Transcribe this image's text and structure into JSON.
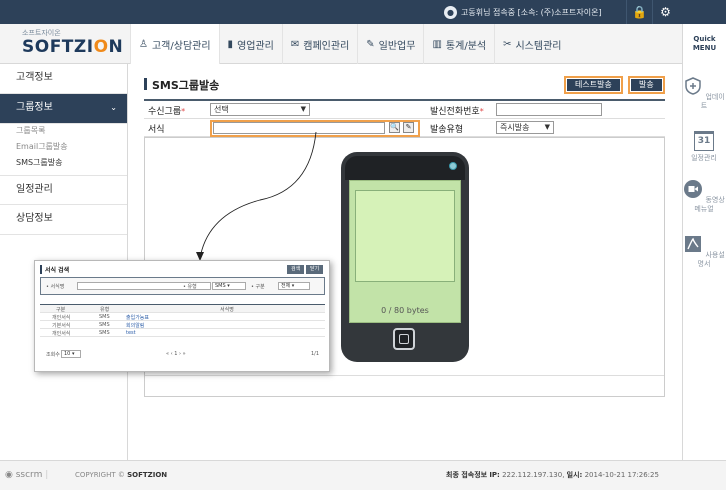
{
  "topbar": {
    "user_status": "고동휘님 접속중 [소속: (주)소프트자이온]",
    "icons": [
      "user-icon",
      "lock-icon",
      "gear-icon"
    ]
  },
  "header": {
    "logo_small": "소프트자이온",
    "logo_main": "SOFTZI",
    "logo_o": "O",
    "logo_n": "N",
    "quick_menu_line1": "Quick",
    "quick_menu_line2": "MENU"
  },
  "nav": [
    {
      "label": "고객/상담관리",
      "icon": "people-icon",
      "glyph": "♙"
    },
    {
      "label": "영업관리",
      "icon": "bookmark-icon",
      "glyph": "▮"
    },
    {
      "label": "캠페인관리",
      "icon": "mail-icon",
      "glyph": "✉"
    },
    {
      "label": "일반업무",
      "icon": "edit-icon",
      "glyph": "✎"
    },
    {
      "label": "통계/분석",
      "icon": "bar-chart-icon",
      "glyph": "▥"
    },
    {
      "label": "시스템관리",
      "icon": "tools-icon",
      "glyph": "✂"
    }
  ],
  "sidebar": {
    "items": [
      {
        "label": "고객정보"
      },
      {
        "label": "그룹정보",
        "chevron": "⌄"
      },
      {
        "label": "일정관리"
      },
      {
        "label": "상담정보"
      }
    ],
    "sub_items": [
      "그룹목록",
      "Email그룹발송",
      "SMS그룹발송"
    ]
  },
  "rail": [
    {
      "label": "업데이트",
      "icon": "shield-plus-icon"
    },
    {
      "label": "일정관리",
      "icon": "calendar-icon",
      "day": "31"
    },
    {
      "label": "동영상 메뉴얼",
      "icon": "video-icon"
    },
    {
      "label": "사용설명서",
      "icon": "pdf-icon"
    }
  ],
  "page": {
    "title": "SMS그룹발송",
    "test_send": "테스트발송",
    "send": "발송"
  },
  "form": {
    "group_label": "수신그룹",
    "group_value": "선택",
    "sender_label": "발신전화번호",
    "template_label": "서식",
    "send_type_label": "발송유형",
    "send_type_value": "즉시발송",
    "required_mark": "*"
  },
  "phone": {
    "byte_count": "0 / 80 bytes"
  },
  "popup": {
    "title": "서식 검색",
    "btn_search": "검색",
    "btn_close": "닫기",
    "filter_name": "• 서식명",
    "filter_type": "• 유형",
    "filter_type_value": "SMS",
    "filter_kind": "• 구분",
    "filter_kind_value": "전체",
    "columns": [
      "구분",
      "유형",
      "서식명"
    ],
    "rows": [
      {
        "kind": "개인서식",
        "type": "SMS",
        "name": "출입가능표"
      },
      {
        "kind": "기본서식",
        "type": "SMS",
        "name": "회의알림"
      },
      {
        "kind": "개인서식",
        "type": "SMS",
        "name": "test"
      }
    ],
    "per_page_label": "조회수",
    "per_page": "10",
    "pagination": "« ‹ 1 › »",
    "page_info": "1/1"
  },
  "footer": {
    "brand": "sscrm",
    "copyright_prefix": "COPYRIGHT ©",
    "copyright_company": "SOFTZION",
    "last_login_label": "최종 접속정보",
    "ip_label": "IP:",
    "ip": "222.112.197.130",
    "date_label": "일시:",
    "date": "2014-10-21 17:26:25"
  }
}
